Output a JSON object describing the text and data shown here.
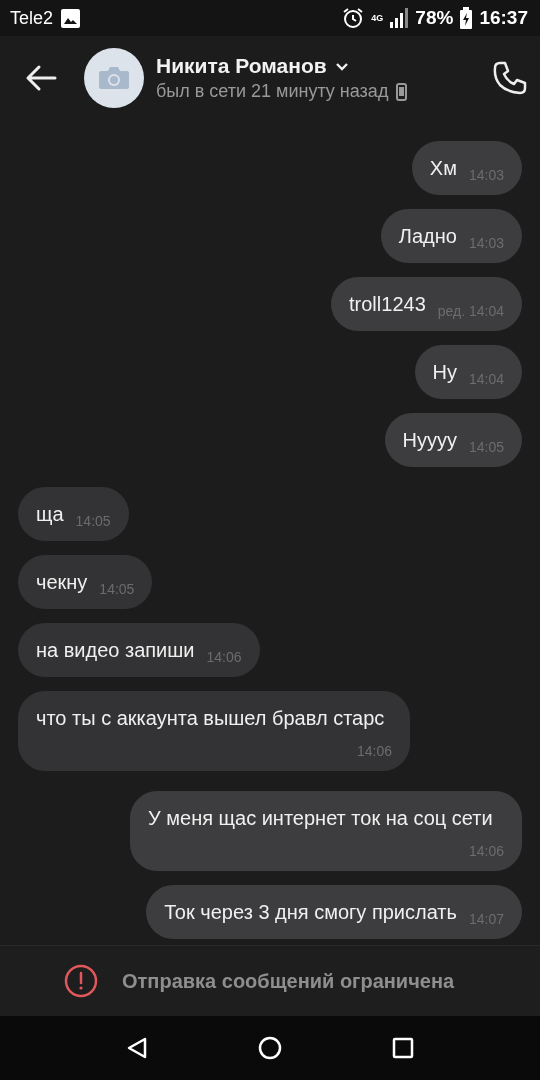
{
  "status_bar": {
    "carrier": "Tele2",
    "network": "4G",
    "battery": "78%",
    "time": "16:37"
  },
  "header": {
    "name": "Никита Романов",
    "status": "был в сети 21 минуту назад"
  },
  "messages": [
    {
      "kind": "outgoing",
      "text": "Хм",
      "time": "14:03"
    },
    {
      "kind": "outgoing",
      "text": "Ладно",
      "time": "14:03"
    },
    {
      "kind": "outgoing",
      "text": "troll1243",
      "edited_label": "ред.",
      "time": "14:04"
    },
    {
      "kind": "outgoing",
      "text": "Ну",
      "time": "14:04"
    },
    {
      "kind": "outgoing",
      "text": "Нуууу",
      "time": "14:05"
    },
    {
      "kind": "incoming",
      "text": "ща",
      "time": "14:05"
    },
    {
      "kind": "incoming",
      "text": "чекну",
      "time": "14:05"
    },
    {
      "kind": "incoming",
      "text": "на видео запиши",
      "time": "14:06"
    },
    {
      "kind": "incoming",
      "text": "что ты с аккаунта вышел бравл старс",
      "time": "14:06"
    },
    {
      "kind": "outgoing",
      "text": "У меня щас интернет ток на соц сети",
      "time": "14:06"
    },
    {
      "kind": "outgoing",
      "text": "Ток через 3 дня смогу прислать",
      "time": "14:07"
    }
  ],
  "footer": {
    "notice": "Отправка сообщений ограничена"
  }
}
